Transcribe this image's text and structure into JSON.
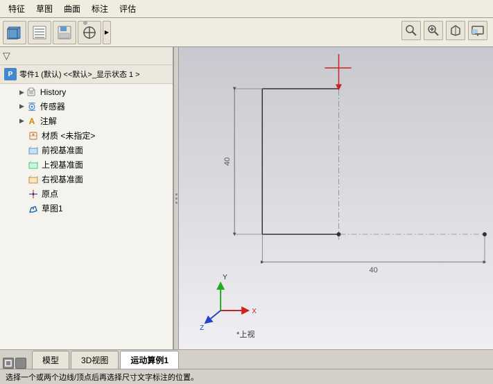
{
  "menu": {
    "items": [
      "特征",
      "草图",
      "曲面",
      "标注",
      "评估"
    ]
  },
  "toolbar": {
    "buttons": [
      {
        "name": "part-icon",
        "symbol": "🔲"
      },
      {
        "name": "feature-tree-icon",
        "symbol": "📋"
      },
      {
        "name": "save-icon",
        "symbol": "💾"
      },
      {
        "name": "target-icon",
        "symbol": "⊕"
      }
    ],
    "more_arrow": "▶",
    "right_icons": [
      {
        "name": "search-icon",
        "symbol": "🔍"
      },
      {
        "name": "zoom-icon",
        "symbol": "🔎"
      },
      {
        "name": "settings-icon",
        "symbol": "⚙"
      },
      {
        "name": "display-icon",
        "symbol": "🖥"
      }
    ]
  },
  "filter": {
    "icon": "▽"
  },
  "tree": {
    "header": "零件1 (默认) <<默认>_显示状态 1 >",
    "items": [
      {
        "id": "history",
        "label": "History",
        "icon": "📁",
        "indent": 1,
        "expanded": false,
        "has_arrow": true
      },
      {
        "id": "sensor",
        "label": "传感器",
        "icon": "📡",
        "indent": 1,
        "expanded": false,
        "has_arrow": true
      },
      {
        "id": "annotation",
        "label": "注解",
        "icon": "A",
        "indent": 1,
        "expanded": false,
        "has_arrow": true
      },
      {
        "id": "material",
        "label": "材质 <未指定>",
        "icon": "◈",
        "indent": 1,
        "expanded": false,
        "has_arrow": false
      },
      {
        "id": "front-plane",
        "label": "前视基准面",
        "icon": "▭",
        "indent": 1,
        "expanded": false,
        "has_arrow": false
      },
      {
        "id": "top-plane",
        "label": "上视基准面",
        "icon": "▭",
        "indent": 1,
        "expanded": false,
        "has_arrow": false
      },
      {
        "id": "right-plane",
        "label": "右视基准面",
        "icon": "▭",
        "indent": 1,
        "expanded": false,
        "has_arrow": false
      },
      {
        "id": "origin",
        "label": "原点",
        "icon": "✦",
        "indent": 1,
        "expanded": false,
        "has_arrow": false
      },
      {
        "id": "sketch1",
        "label": "草图1",
        "icon": "✏",
        "indent": 1,
        "expanded": false,
        "has_arrow": false
      }
    ]
  },
  "viewport": {
    "view_label": "*上视",
    "coord": {
      "x_label": "X",
      "z_label": "Z"
    },
    "drawing": {
      "dim_vertical": "40",
      "dim_horizontal": "40"
    }
  },
  "tabs": [
    {
      "id": "model",
      "label": "模型",
      "active": false
    },
    {
      "id": "3d-view",
      "label": "3D视图",
      "active": false
    },
    {
      "id": "motion-example",
      "label": "运动算例1",
      "active": true
    }
  ],
  "status_bar": {
    "text": "选择一个或两个边线/顶点后再选择尺寸文字标注的位置。"
  }
}
